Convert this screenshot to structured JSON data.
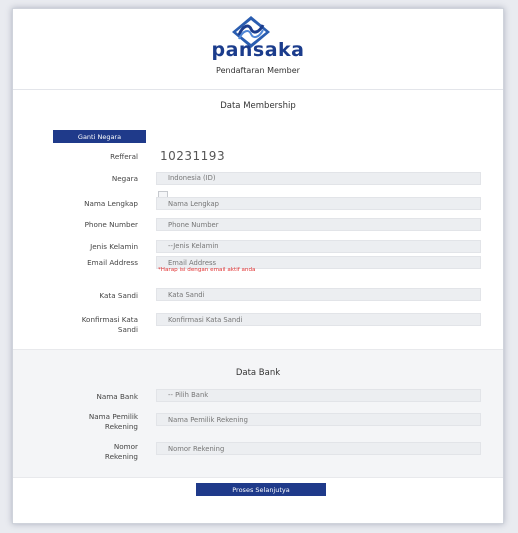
{
  "header": {
    "logo_text": "pansaka",
    "subtitle": "Pendaftaran Member"
  },
  "membership": {
    "title": "Data Membership",
    "change_country_button": "Ganti Negara",
    "referral": {
      "label": "Refferal",
      "value": "10231193"
    },
    "country": {
      "label": "Negara",
      "value": "Indonesia (ID)"
    },
    "full_name": {
      "label": "Nama Lengkap",
      "placeholder": "Nama Lengkap"
    },
    "phone": {
      "label": "Phone Number",
      "placeholder": "Phone Number"
    },
    "gender": {
      "label": "Jenis Kelamin",
      "value": "--Jenis Kelamin"
    },
    "email": {
      "label": "Email Address",
      "placeholder": "Email Address",
      "hint": "*Harap isi dengan email aktif anda"
    },
    "password": {
      "label": "Kata Sandi",
      "placeholder": "Kata Sandi"
    },
    "confirm_password": {
      "label_line1": "Konfirmasi Kata",
      "label_line2": "Sandi",
      "placeholder": "Konfirmasi Kata Sandi"
    }
  },
  "bank": {
    "title": "Data Bank",
    "bank_name": {
      "label": "Nama Bank",
      "value": "-- Pilih Bank"
    },
    "account_holder": {
      "label_line1": "Nama Pemilik",
      "label_line2": "Rekening",
      "placeholder": "Nama Pemilik Rekening"
    },
    "account_number": {
      "label_line1": "Nomor",
      "label_line2": "Rekening",
      "placeholder": "Nomor Rekening"
    }
  },
  "submit_button": "Proses Selanjutya",
  "colors": {
    "brand": "#1f3a8a",
    "hint": "#e23232",
    "field_bg": "#eceef1"
  }
}
